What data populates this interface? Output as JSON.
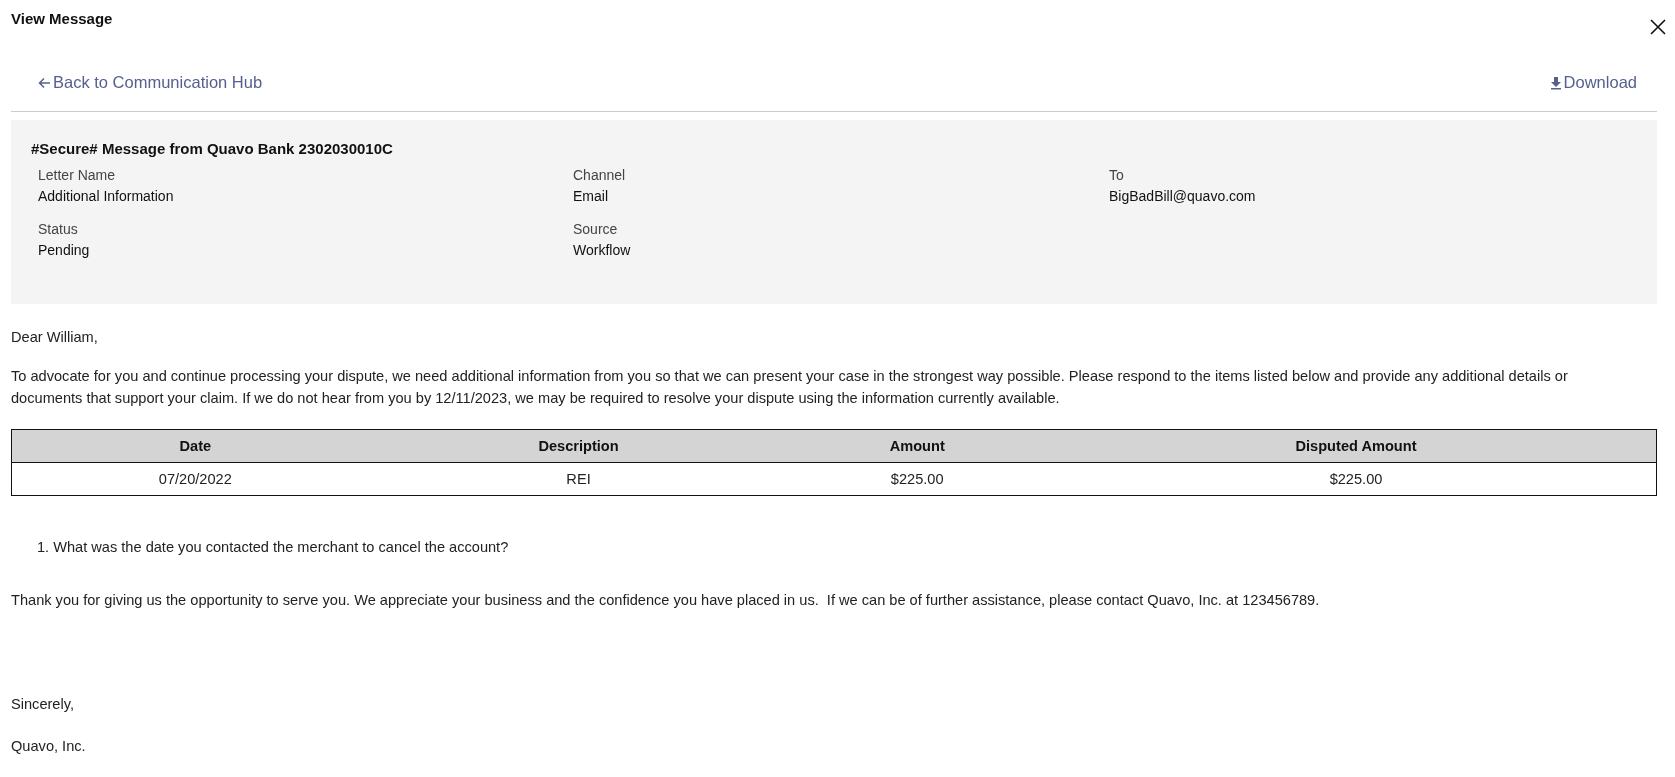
{
  "window": {
    "title": "View Message"
  },
  "toolbar": {
    "back_link": "Back to Communication Hub",
    "download_link": "Download"
  },
  "summary": {
    "subject": "#Secure# Message from Quavo Bank 2302030010C",
    "fields": [
      {
        "label": "Letter Name",
        "value": "Additional Information"
      },
      {
        "label": "Channel",
        "value": "Email"
      },
      {
        "label": "To",
        "value": "BigBadBill@quavo.com"
      },
      {
        "label": "Status",
        "value": "Pending"
      },
      {
        "label": "Source",
        "value": "Workflow"
      }
    ]
  },
  "letter": {
    "greeting": "Dear William,",
    "intro": "To advocate for you and continue processing your dispute, we need additional information from you so that we can present your case in the strongest way possible. Please respond to the items listed below and provide any additional details or documents that support your claim. If we do not hear from you by 12/11/2023, we may be required to resolve your dispute using the information currently available.",
    "table": {
      "columns": [
        "Date",
        "Description",
        "Amount",
        "Disputed Amount"
      ],
      "rows": [
        [
          "07/20/2022",
          "REI",
          "$225.00",
          "$225.00"
        ]
      ]
    },
    "questions": [
      {
        "number": "1.",
        "text": "What was the date you contacted the merchant to cancel the account?"
      }
    ],
    "closing": "Thank you for giving us the opportunity to serve you. We appreciate your business and the confidence you have placed in us.  If we can be of further assistance, please contact Quavo, Inc. at 123456789.",
    "sign_off": "Sincerely,",
    "signature": "Quavo, Inc."
  }
}
